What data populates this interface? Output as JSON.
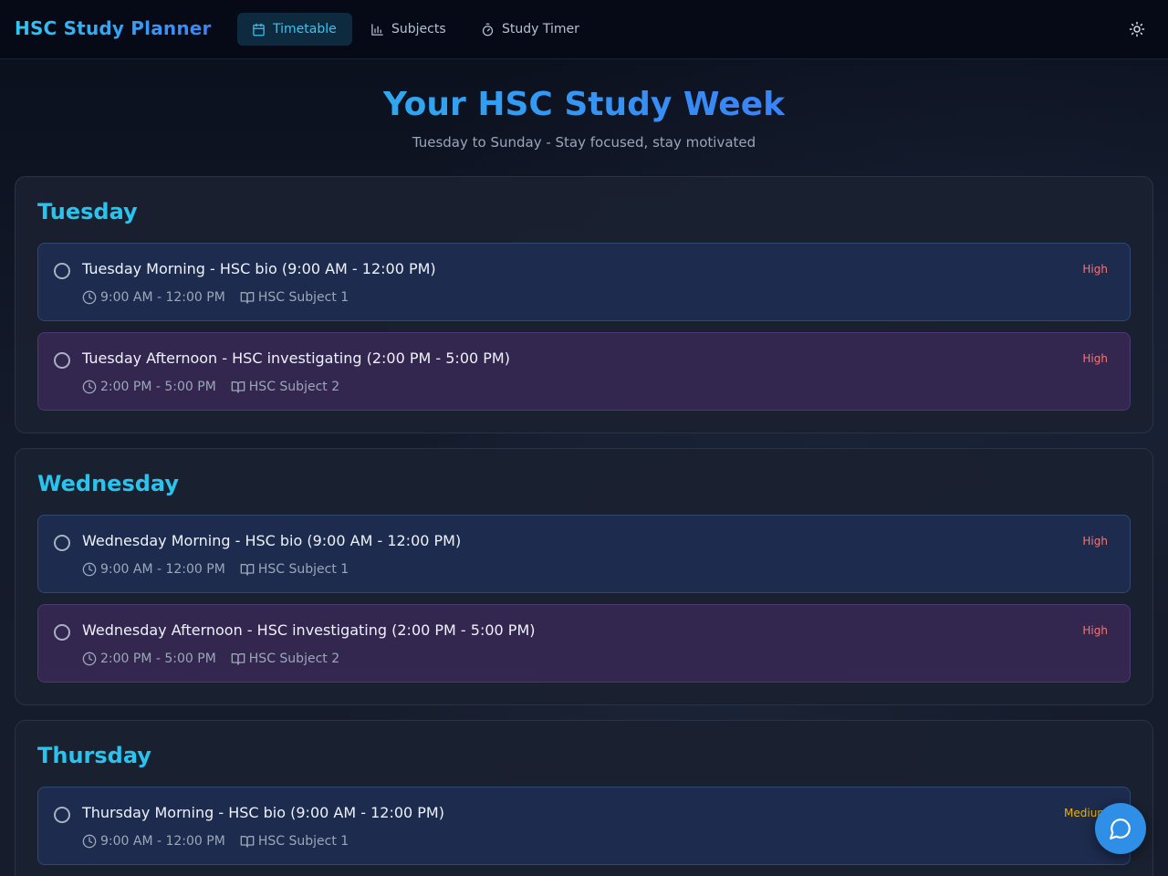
{
  "app": {
    "title": "HSC Study Planner"
  },
  "nav": {
    "timetable": "Timetable",
    "subjects": "Subjects",
    "timer": "Study Timer"
  },
  "hero": {
    "title": "Your HSC Study Week",
    "subtitle": "Tuesday to Sunday - Stay focused, stay motivated"
  },
  "colors": {
    "accent": "#29c3ee",
    "blue_card": "#1d2b4e",
    "purple_card": "#33264f",
    "priority_high": "#f07878",
    "priority_medium": "#e9b400",
    "fab": "#2f8fe6"
  },
  "icons": {
    "nav_timetable": "calendar-icon",
    "nav_subjects": "bar-chart-icon",
    "nav_timer": "timer-icon",
    "theme": "sun-icon",
    "time": "clock-icon",
    "subject": "book-open-icon",
    "fab": "chat-bubble-icon"
  },
  "days": [
    {
      "name": "Tuesday",
      "sessions": [
        {
          "title": "Tuesday Morning - HSC bio (9:00 AM - 12:00 PM)",
          "time": "9:00 AM - 12:00 PM",
          "subject": "HSC Subject 1",
          "priority": "High",
          "completed": false
        },
        {
          "title": "Tuesday Afternoon - HSC investigating (2:00 PM - 5:00 PM)",
          "time": "2:00 PM - 5:00 PM",
          "subject": "HSC Subject 2",
          "priority": "High",
          "completed": false
        }
      ]
    },
    {
      "name": "Wednesday",
      "sessions": [
        {
          "title": "Wednesday Morning - HSC bio (9:00 AM - 12:00 PM)",
          "time": "9:00 AM - 12:00 PM",
          "subject": "HSC Subject 1",
          "priority": "High",
          "completed": false
        },
        {
          "title": "Wednesday Afternoon - HSC investigating (2:00 PM - 5:00 PM)",
          "time": "2:00 PM - 5:00 PM",
          "subject": "HSC Subject 2",
          "priority": "High",
          "completed": false
        }
      ]
    },
    {
      "name": "Thursday",
      "sessions": [
        {
          "title": "Thursday Morning - HSC bio (9:00 AM - 12:00 PM)",
          "time": "9:00 AM - 12:00 PM",
          "subject": "HSC Subject 1",
          "priority": "Medium",
          "completed": false
        }
      ]
    }
  ]
}
